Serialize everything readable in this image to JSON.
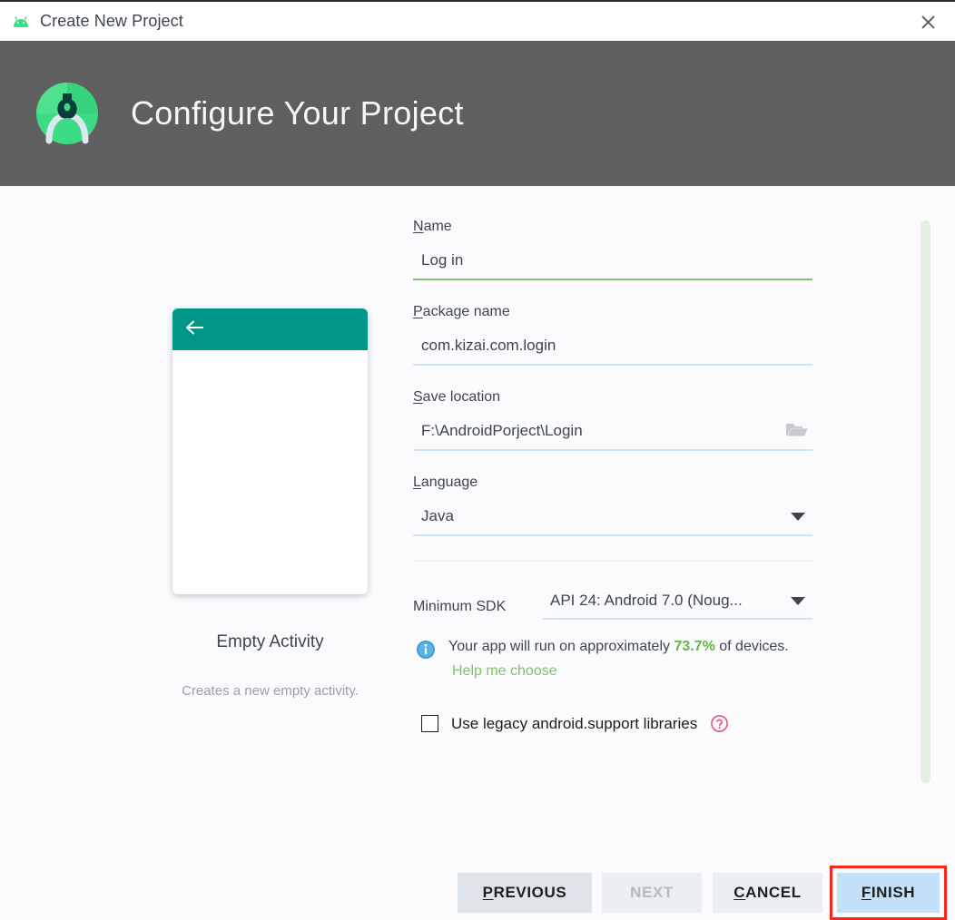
{
  "window": {
    "title": "Create New Project",
    "app_icon": "android-icon",
    "close_icon": "close-icon"
  },
  "header": {
    "title": "Configure Your Project",
    "logo_icon": "android-studio-logo-icon",
    "background": "#5f5f5f"
  },
  "preview": {
    "template_name": "Empty Activity",
    "template_description": "Creates a new empty activity.",
    "appbar_color": "#009688",
    "back_arrow_icon": "back-arrow-icon"
  },
  "form": {
    "name": {
      "label": "Name",
      "mnemonic": "N",
      "label_rest": "ame",
      "value": "Log in",
      "focused": true,
      "underline_color": "#7fc26b"
    },
    "package_name": {
      "label": "Package name",
      "mnemonic": "P",
      "label_rest": "ackage name",
      "value": "com.kizai.com.login",
      "underline_color": "#cfe4f7"
    },
    "save_location": {
      "label": "Save location",
      "mnemonic": "S",
      "label_rest": "ave location",
      "value": "F:\\AndroidPorject\\Login",
      "browse_icon": "folder-open-icon",
      "underline_color": "#cfe4f7"
    },
    "language": {
      "label": "Language",
      "mnemonic": "L",
      "label_rest": "anguage",
      "value": "Java",
      "dropdown_icon": "chevron-down-icon",
      "underline_color": "#cfe4f7"
    },
    "minimum_sdk": {
      "label": "Minimum SDK",
      "value": "API 24: Android 7.0 (Noug...",
      "dropdown_icon": "chevron-down-icon",
      "underline_color": "#cfe4f7"
    },
    "device_info": {
      "icon": "info-icon",
      "text_before": "Your app will run on approximately ",
      "percent": "73.7%",
      "text_after": " of devices.",
      "help_link": "Help me choose",
      "percent_color": "#62b349",
      "link_color": "#7fc26b"
    },
    "legacy_checkbox": {
      "label": "Use legacy android.support libraries",
      "checked": false,
      "help_icon": "question-mark-icon",
      "help_icon_color": "#e8537a"
    }
  },
  "scrollbar": {
    "thumb_color": "#e4f0e1"
  },
  "footer": {
    "buttons": [
      {
        "name": "previous",
        "mnemonic": "P",
        "rest": "REVIOUS",
        "label": "PREVIOUS",
        "enabled": true
      },
      {
        "name": "next",
        "mnemonic": "",
        "rest": "NEXT",
        "label": "NEXT",
        "enabled": false
      },
      {
        "name": "cancel",
        "mnemonic": "C",
        "rest": "ANCEL",
        "label": "CANCEL",
        "enabled": true
      },
      {
        "name": "finish",
        "mnemonic": "F",
        "rest": "INISH",
        "label": "FINISH",
        "enabled": true
      }
    ],
    "highlight_color": "#f8271a"
  }
}
